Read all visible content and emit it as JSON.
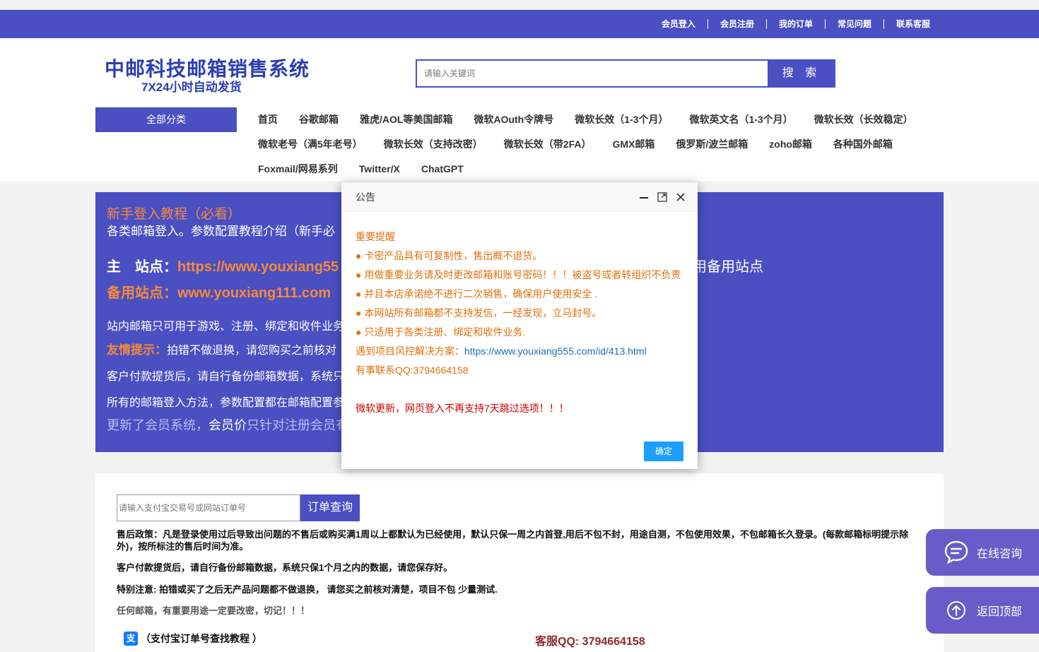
{
  "topbar": {
    "links": [
      "会员登入",
      "会员注册",
      "我的订单",
      "常见问题",
      "联系客服"
    ]
  },
  "header": {
    "logo_main": "中邮科技邮箱销售系统",
    "logo_sub": "7X24小时自动发货",
    "search_placeholder": "请输入关键词",
    "search_button": "搜 索",
    "all_categories": "全部分类",
    "nav": [
      "首页",
      "谷歌邮箱",
      "雅虎/AOL等美国邮箱",
      "微软AOuth令牌号",
      "微软长效（1-3个月）",
      "微软英文名（1-3个月）",
      "微软长效（长效稳定）",
      "微软老号（满5年老号）",
      "微软长效（支持改密）",
      "微软长效（带2FA）",
      "GMX邮箱",
      "俄罗斯/波兰邮箱",
      "zoho邮箱",
      "各种国外邮箱",
      "Foxmail/网易系列",
      "Twitter/X",
      "ChatGPT"
    ]
  },
  "notice": {
    "title": "新手登入教程（必看）",
    "subtitle": "各类邮箱登入。参数配置教程介绍（新手必",
    "main_label": "主　站点：",
    "main_url": "https://www.youxiang55",
    "right_text": "用备用站点",
    "backup": "备用站点：www.youxiang111.com",
    "line1": "站内邮箱只可用于游戏、注册、绑定和收件业务",
    "tip_label": "友情提示：",
    "tip_text": "拍错不做退换，请您购买之前核对",
    "line3": "客户付款提货后，请自行备份邮箱数据，系统只",
    "line4": "所有的邮箱登入方法，参数配置都在邮箱配置参",
    "line5_a": "更新了会员系统，",
    "line5_b": "会员价",
    "line5_c": "只针对注册会员有"
  },
  "order": {
    "placeholder": "请输入支付宝交易号或网站订单号",
    "button": "订单查询",
    "policy1": "售后政策：凡是登录使用过后导致出问题的不售后或购买满1周以上都默认为已经使用，默认只保一周之内首登,用后不包不封，用途自测，不包使用效果，不包邮箱长久登录。(每款邮箱标明提示除外)，按所标注的售后时间为准。",
    "policy2": "客户付款提货后，请自行备份邮箱数据，系统只保1个月之内的数据，请您保存好。",
    "policy3": "特别注意: 拍错或买了之后无产品问题都不做退换， 请您买之前核对清楚，项目不包 少量测试.",
    "policy4": "任何邮箱，有重要用途一定要改密，切记！！！",
    "alipay_icon": "支",
    "alipay": "（支付宝订单号查找教程 ）",
    "service_qq": "客服QQ:  3794664158"
  },
  "side": {
    "consult": "在线咨询",
    "top": "返回顶部"
  },
  "modal": {
    "title": "公告",
    "heading": "重要提醒",
    "items": [
      "● 卡密产品具有可复制性，售出概不退货。",
      "● 用做重要业务请及时更改邮箱和账号密码！！！被盗号或者转组织不负责",
      "● 并且本店承诺绝不进行二次销售，确保用户使用安全 .",
      "● 本网站所有邮箱都不支持发信，一经发现，立马封号。",
      "● 只适用于各类注册、绑定和收件业务."
    ],
    "risk_label": "遇到项目风控解决方案：",
    "risk_url": "https://www.youxiang555.com/id/413.html",
    "contact": "有事联系QQ:3794664158",
    "update": "微软更新，网页登入不再支持7天跳过选项！！！",
    "ok": "确定"
  }
}
